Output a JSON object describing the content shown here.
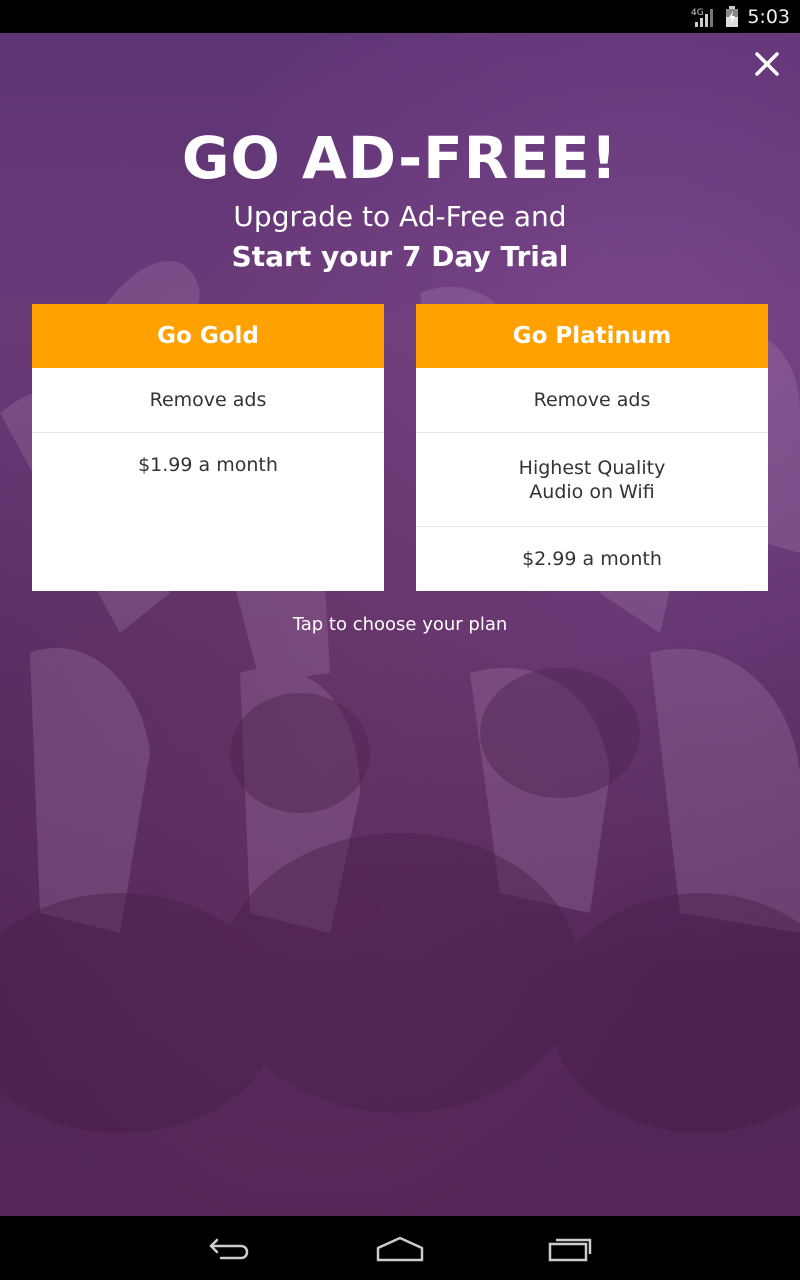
{
  "status_bar": {
    "network": "4G",
    "time": "5:03",
    "icons": [
      "signal-icon",
      "battery-icon"
    ]
  },
  "dialog": {
    "close_icon": "close-icon",
    "headline": "GO AD-FREE!",
    "subline": "Upgrade to Ad-Free and",
    "subline_bold": "Start your 7 Day Trial",
    "plans": [
      {
        "title": "Go Gold",
        "features": [
          "Remove ads",
          "$1.99 a month"
        ]
      },
      {
        "title": "Go Platinum",
        "features": [
          "Remove ads",
          "Highest Quality\nAudio on Wifi",
          "$2.99 a month"
        ]
      }
    ],
    "hint": "Tap to choose your plan"
  },
  "colors": {
    "accent": "#ffa100",
    "background": "#5e3475",
    "card": "#ffffff"
  },
  "nav_bar": {
    "icons": [
      "back-icon",
      "home-icon",
      "recents-icon"
    ]
  }
}
